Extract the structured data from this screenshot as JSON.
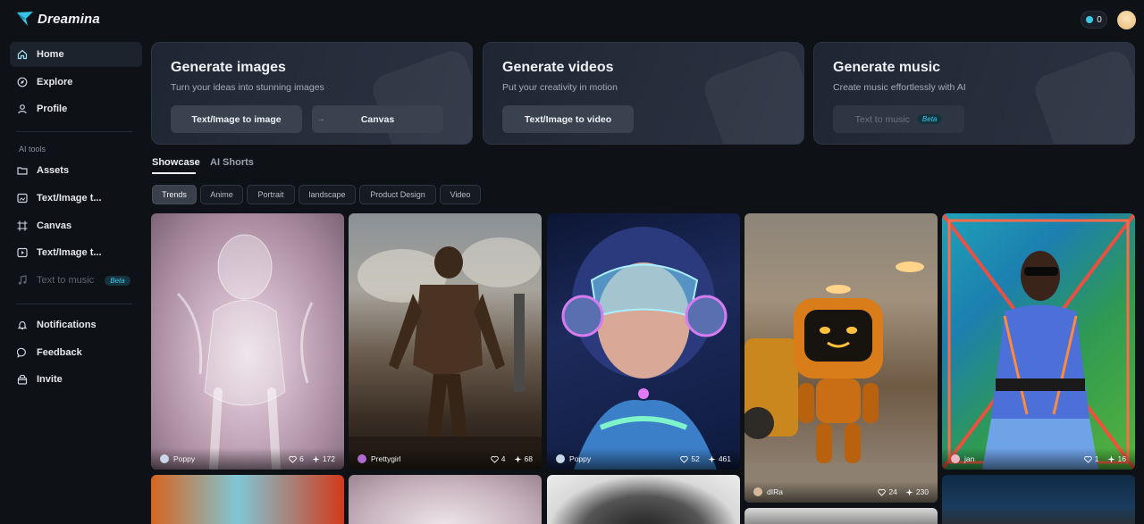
{
  "app": {
    "name": "Dreamina"
  },
  "header": {
    "credits": "0"
  },
  "sidebar": {
    "items": [
      {
        "label": "Home",
        "icon": "home-icon"
      },
      {
        "label": "Explore",
        "icon": "compass-icon"
      },
      {
        "label": "Profile",
        "icon": "user-icon"
      }
    ],
    "section_label": "AI tools",
    "tools": [
      {
        "label": "Assets",
        "icon": "folder-icon"
      },
      {
        "label": "Text/Image t...",
        "icon": "image-edit-icon"
      },
      {
        "label": "Canvas",
        "icon": "canvas-icon"
      },
      {
        "label": "Text/Image t...",
        "icon": "video-icon"
      },
      {
        "label": "Text to music",
        "icon": "music-icon",
        "badge": "Beta"
      }
    ],
    "bottom": [
      {
        "label": "Notifications",
        "icon": "bell-icon"
      },
      {
        "label": "Feedback",
        "icon": "chat-icon"
      },
      {
        "label": "Invite",
        "icon": "gift-icon"
      }
    ]
  },
  "cards": [
    {
      "title": "Generate images",
      "subtitle": "Turn your ideas into stunning images",
      "buttons": [
        "Text/Image to image",
        "Canvas"
      ]
    },
    {
      "title": "Generate videos",
      "subtitle": "Put your creativity in motion",
      "buttons": [
        "Text/Image to video"
      ]
    },
    {
      "title": "Generate music",
      "subtitle": "Create music effortlessly with AI",
      "buttons": [
        "Text to music"
      ],
      "badge": "Beta"
    }
  ],
  "tabs": [
    "Showcase",
    "AI Shorts"
  ],
  "filters": [
    "Trends",
    "Anime",
    "Portrait",
    "landscape",
    "Product Design",
    "Video"
  ],
  "gallery": [
    {
      "user": "Poppy",
      "likes": "6",
      "uses": "172"
    },
    {
      "user": "Prettygirl",
      "likes": "4",
      "uses": "68"
    },
    {
      "user": "Poppy",
      "likes": "52",
      "uses": "461"
    },
    {
      "user": "dIRa",
      "likes": "24",
      "uses": "230"
    },
    {
      "user": "jan",
      "likes": "1",
      "uses": "16"
    }
  ],
  "colors": {
    "accent": "#38c8e8",
    "background": "#0e1116",
    "card": "#262e3c"
  }
}
